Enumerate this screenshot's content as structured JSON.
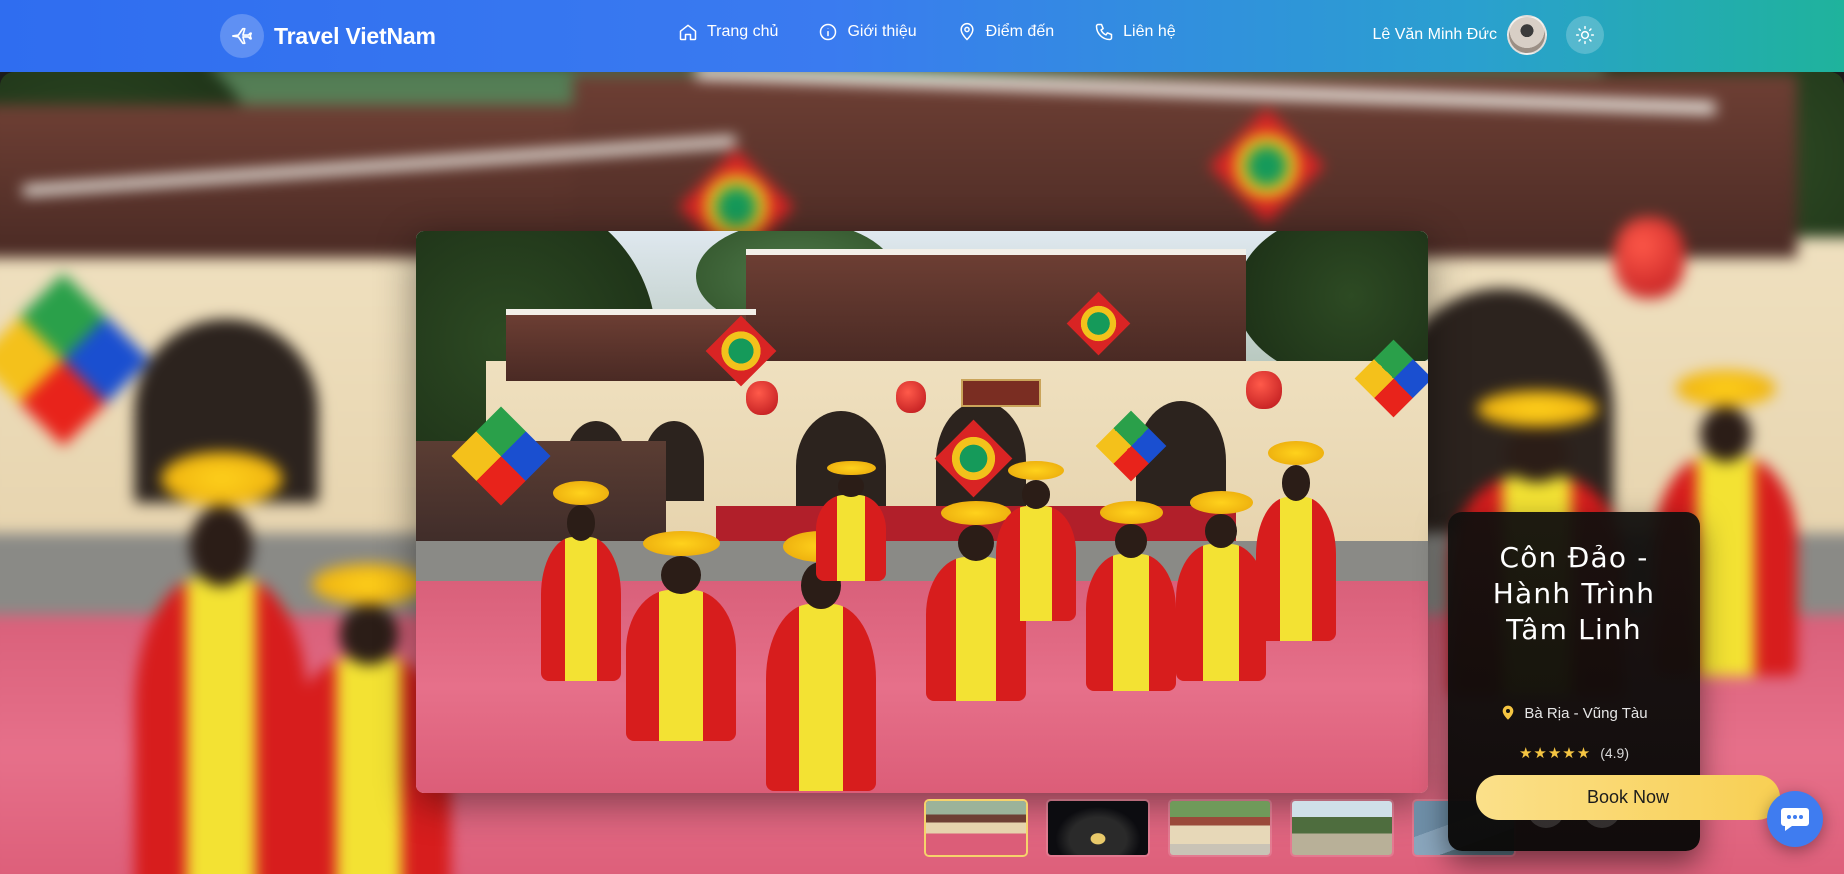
{
  "navbar": {
    "brand": "Travel VietNam",
    "links": [
      {
        "label": "Trang chủ",
        "icon": "home-icon"
      },
      {
        "label": "Giới thiệu",
        "icon": "info-icon"
      },
      {
        "label": "Điểm đến",
        "icon": "map-pin-icon"
      },
      {
        "label": "Liên hệ",
        "icon": "phone-icon"
      }
    ],
    "user_name": "Lê Văn Minh Đức",
    "theme_icon": "sun-icon"
  },
  "hero": {
    "title": "Côn Đảo - Hành Trình Tâm Linh",
    "location": "Bà Rịa - Vũng Tàu",
    "stars": "★★★★★",
    "rating": "(4.9)",
    "book_label": "Book Now",
    "thumbnail_count": 5,
    "active_thumbnail": 1
  },
  "colors": {
    "nav_gradient_start": "#2f6df0",
    "nav_gradient_end": "#1fb39c",
    "book_button": "#f8cf53",
    "star": "#f5c542",
    "chat_button": "#3f7cf0"
  }
}
